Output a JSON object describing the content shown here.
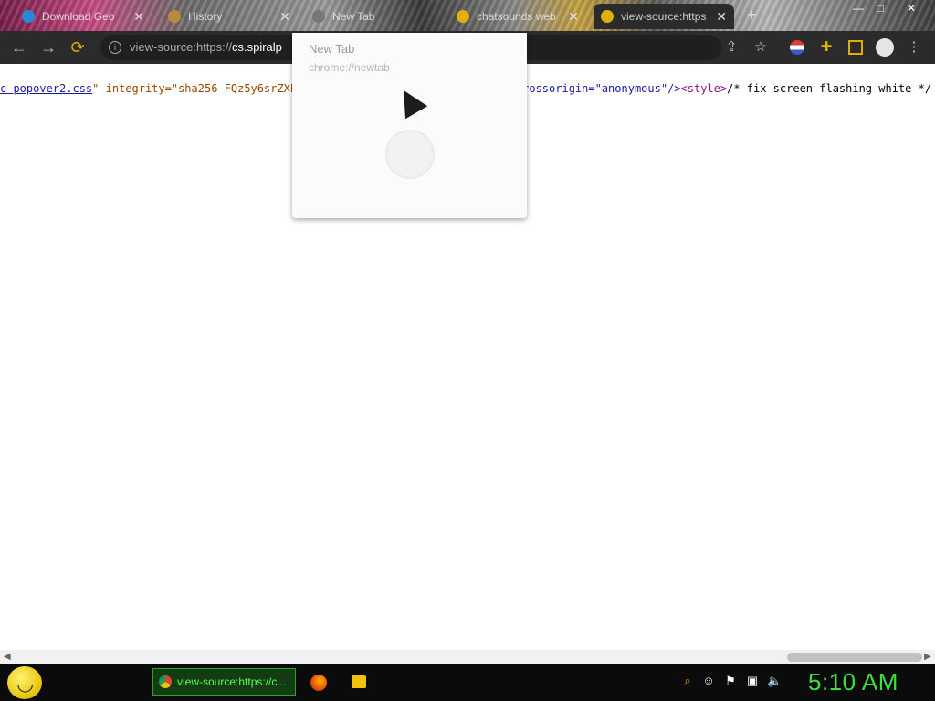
{
  "browser": {
    "tabs": [
      {
        "title": "Download Geo",
        "favicon_color": "#2a87d8",
        "active": false
      },
      {
        "title": "History",
        "favicon_color": "#b98a3a",
        "active": false
      },
      {
        "title": "New Tab",
        "favicon_color": "#777777",
        "active": false
      },
      {
        "title": "chatsounds web",
        "favicon_color": "#e0b000",
        "active": false
      },
      {
        "title": "view-source:https",
        "favicon_color": "#e0b000",
        "active": true
      }
    ],
    "close_glyph": "✕",
    "new_tab_glyph": "+",
    "window_controls": {
      "minimize": "—",
      "maximize": "□",
      "close": "✕"
    },
    "nav": {
      "back": "←",
      "forward": "→",
      "reload": "⟳"
    },
    "omnibox": {
      "prefix": "view-source:https://",
      "host": "cs.spiralp",
      "info_glyph": "i"
    },
    "toolbar_icons": [
      "share-icon",
      "star-icon",
      "profile-flag-icon",
      "extensions-icon",
      "sidepanel-icon",
      "avatar-icon",
      "menu-icon"
    ]
  },
  "source_view": {
    "link_text": "c-popover2.css",
    "seg1": "\" integrity=\"sha256-FQz5y6srZXE",
    "seg2": "rossorigin=\"anonymous\"/>",
    "tag_style": "<style>",
    "comment": "/* fix screen flashing white */ "
  },
  "hover_card": {
    "title": "New Tab",
    "url": "chrome://newtab"
  },
  "taskbar": {
    "active_task_label": "view-source:https://c...",
    "clock": "5:10 AM",
    "tray_icons": [
      "search-icon",
      "chat-icon",
      "flag-icon",
      "network-icon",
      "volume-icon"
    ]
  },
  "colors": {
    "clock": "#3be03b",
    "task_border": "#2fa02f",
    "toolbar_bg": "#2b2b2b"
  }
}
